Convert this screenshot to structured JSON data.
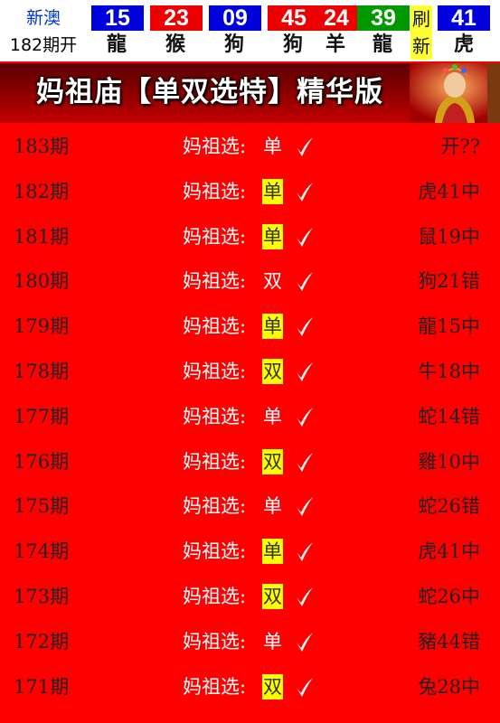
{
  "header": {
    "region": "新澳",
    "period": "182期开",
    "refresh": [
      "刷",
      "新"
    ],
    "balls": [
      {
        "number": "15",
        "zodiac": "龍",
        "color": "#0000dd"
      },
      {
        "number": "23",
        "zodiac": "猴",
        "color": "#ee0000"
      },
      {
        "number": "09",
        "zodiac": "狗",
        "color": "#0000dd"
      },
      {
        "number": "45",
        "zodiac": "狗",
        "color": "#ee0000"
      },
      {
        "number": "24",
        "zodiac": "羊",
        "color": "#ee0000"
      },
      {
        "number": "39",
        "zodiac": "龍",
        "color": "#009900"
      },
      {
        "number": "41",
        "zodiac": "虎",
        "color": "#0000dd"
      }
    ]
  },
  "banner": {
    "title": "妈祖庙【单双选特】精华版"
  },
  "records": [
    {
      "period": "183期",
      "label": "妈祖选:",
      "pick": "单",
      "hit": false,
      "result": "开??"
    },
    {
      "period": "182期",
      "label": "妈祖选:",
      "pick": "单",
      "hit": true,
      "result": "虎41中"
    },
    {
      "period": "181期",
      "label": "妈祖选:",
      "pick": "单",
      "hit": true,
      "result": "鼠19中"
    },
    {
      "period": "180期",
      "label": "妈祖选:",
      "pick": "双",
      "hit": false,
      "result": "狗21错"
    },
    {
      "period": "179期",
      "label": "妈祖选:",
      "pick": "单",
      "hit": true,
      "result": "龍15中"
    },
    {
      "period": "178期",
      "label": "妈祖选:",
      "pick": "双",
      "hit": true,
      "result": "牛18中"
    },
    {
      "period": "177期",
      "label": "妈祖选:",
      "pick": "单",
      "hit": false,
      "result": "蛇14错"
    },
    {
      "period": "176期",
      "label": "妈祖选:",
      "pick": "双",
      "hit": true,
      "result": "雞10中"
    },
    {
      "period": "175期",
      "label": "妈祖选:",
      "pick": "单",
      "hit": false,
      "result": "蛇26错"
    },
    {
      "period": "174期",
      "label": "妈祖选:",
      "pick": "单",
      "hit": true,
      "result": "虎41中"
    },
    {
      "period": "173期",
      "label": "妈祖选:",
      "pick": "双",
      "hit": true,
      "result": "蛇26中"
    },
    {
      "period": "172期",
      "label": "妈祖选:",
      "pick": "单",
      "hit": false,
      "result": "豬44错"
    },
    {
      "period": "171期",
      "label": "妈祖选:",
      "pick": "双",
      "hit": true,
      "result": "兔28中"
    }
  ]
}
